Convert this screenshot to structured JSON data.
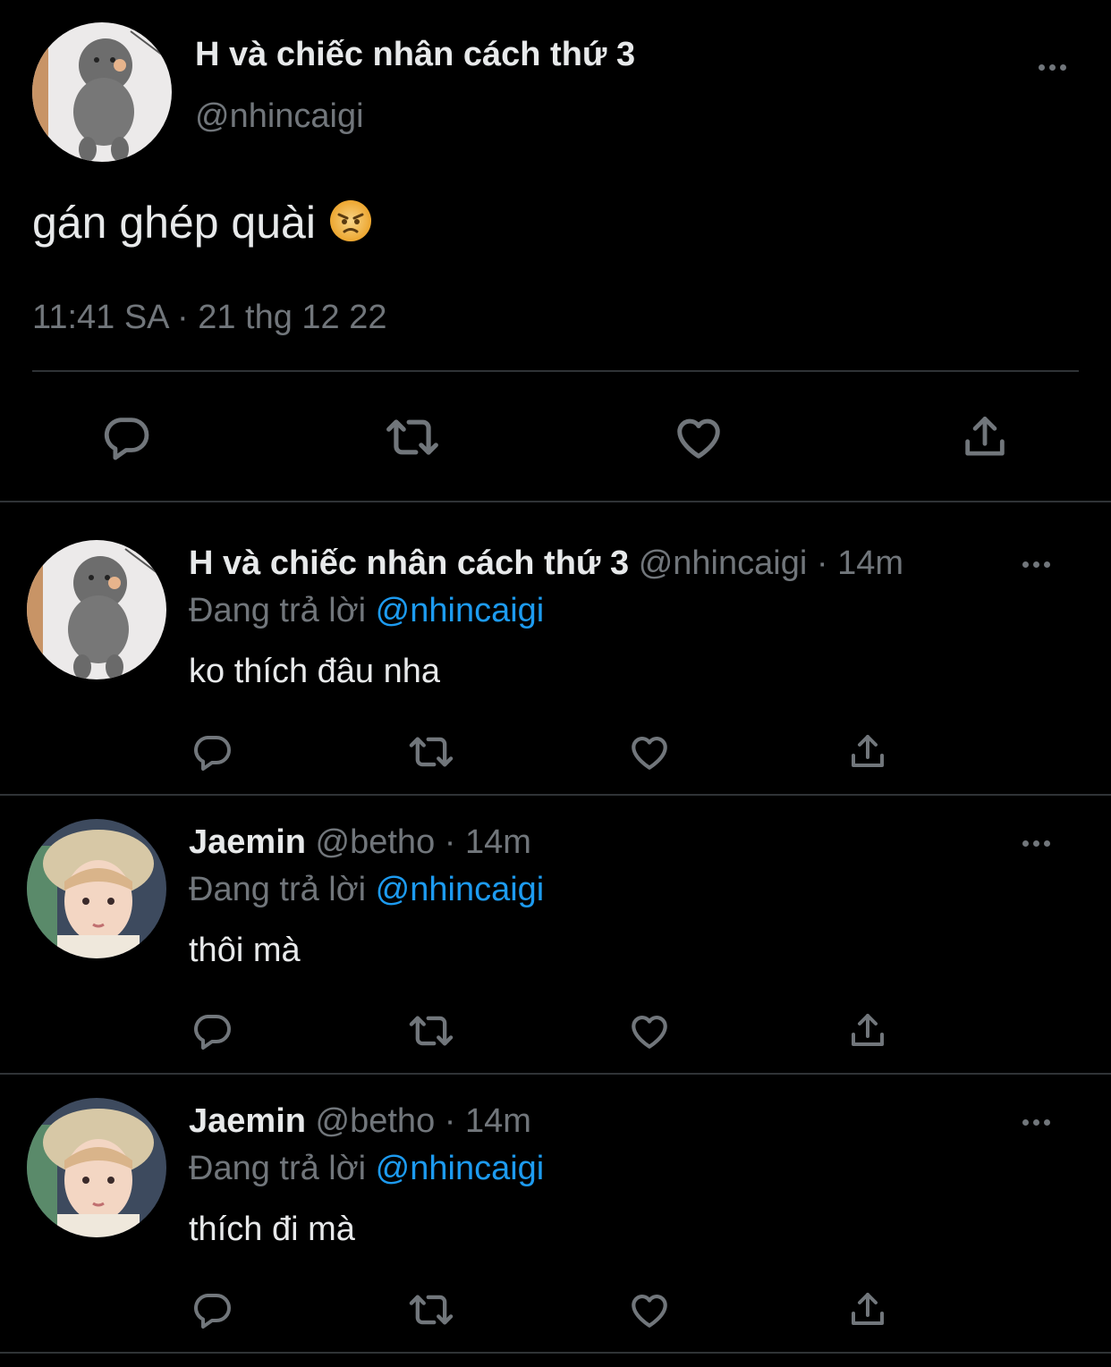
{
  "main_tweet": {
    "display_name": "H và chiếc nhân cách thứ 3",
    "handle": "@nhincaigi",
    "text": "gán ghép quài",
    "timestamp": "11:41 SA · 21 thg 12 22",
    "emoji": "angry-face-emoji"
  },
  "replies": [
    {
      "display_name": "H và chiếc nhân cách thứ 3",
      "handle": "@nhincaigi",
      "sep": "·",
      "time": "14m",
      "replying_prefix": "Đang trả lời",
      "replying_to": "@nhincaigi",
      "text": "ko thích đâu nha"
    },
    {
      "display_name": "Jaemin",
      "handle": "@betho",
      "sep": "·",
      "time": "14m",
      "replying_prefix": "Đang trả lời",
      "replying_to": "@nhincaigi",
      "text": "thôi mà"
    },
    {
      "display_name": "Jaemin",
      "handle": "@betho",
      "sep": "·",
      "time": "14m",
      "replying_prefix": "Đang trả lời",
      "replying_to": "@nhincaigi",
      "text": "thích đi mà"
    }
  ],
  "colors": {
    "background": "#000000",
    "text": "#e7e9ea",
    "muted": "#71767b",
    "link": "#1d9bf0",
    "divider": "#2f3336"
  },
  "icons": [
    "reply-icon",
    "retweet-icon",
    "like-icon",
    "share-icon",
    "more-icon"
  ]
}
